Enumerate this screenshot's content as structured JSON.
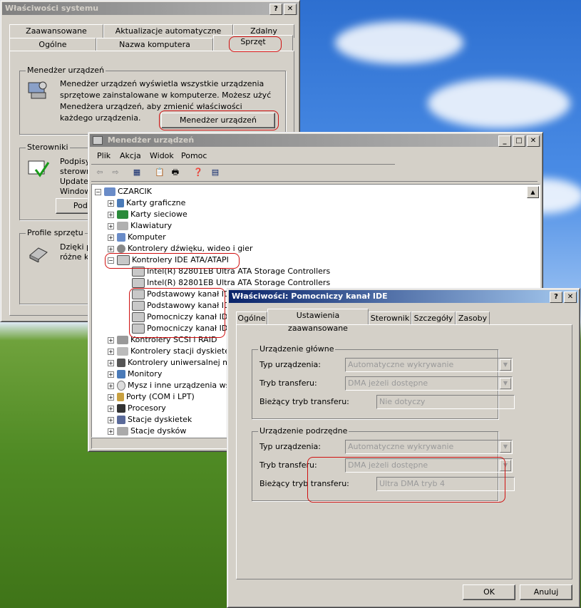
{
  "colors": {
    "highlight_red": "#d01010",
    "title_active": "#0a246a",
    "title_inactive": "#808080"
  },
  "sys_props": {
    "title": "Właściwości systemu",
    "help_btn": "?",
    "close_btn": "✕",
    "tabs_top": [
      "Zaawansowane",
      "Aktualizacje automatyczne",
      "Zdalny"
    ],
    "tabs_bottom": [
      "Ogólne",
      "Nazwa komputera",
      "Sprzęt"
    ],
    "devmgr_group": {
      "title": "Menedżer urządzeń",
      "text": "Menedżer urządzeń wyświetla wszystkie urządzenia sprzętowe zainstalowane w komputerze. Możesz użyć Menedżera urządzeń, aby zmienić właściwości każdego urządzenia.",
      "button": "Menedżer urządzeń"
    },
    "drivers_group": {
      "title": "Sterowniki",
      "lines": [
        "Podpisy",
        "sterown",
        "Update",
        "Window"
      ],
      "button": "Podpisy"
    },
    "profiles_group": {
      "title": "Profile sprzętu",
      "lines": [
        "Dzięki p",
        "różne ko"
      ]
    }
  },
  "dev_mgr": {
    "title": "Menedżer urządzeń",
    "min_btn": "_",
    "max_btn": "□",
    "close_btn": "✕",
    "menu": [
      "Plik",
      "Akcja",
      "Widok",
      "Pomoc"
    ],
    "toolbar_icons": [
      "back-icon",
      "forward-icon",
      "view-icon",
      "properties-icon",
      "print-icon",
      "help-icon",
      "details-icon"
    ],
    "toolbar_glyphs": [
      "⇦",
      "⇨",
      "▦",
      "📋",
      "🖶",
      "❓",
      "▤"
    ],
    "root": "CZARCIK",
    "items": [
      "Karty graficzne",
      "Karty sieciowe",
      "Klawiatury",
      "Komputer",
      "Kontrolery dźwięku, wideo i gier",
      "Kontrolery IDE ATA/ATAPI"
    ],
    "ide_children": [
      "Intel(R) 82801EB Ultra ATA Storage Controllers",
      "Intel(R) 82801EB Ultra ATA Storage Controllers",
      "Podstawowy kanał IDE",
      "Podstawowy kanał IDE",
      "Pomocniczy kanał IDE",
      "Pomocniczy kanał IDE"
    ],
    "items_after": [
      "Kontrolery SCSI i RAID",
      "Kontrolery stacji dyskietek",
      "Kontrolery uniwersalnej ma",
      "Monitory",
      "Mysz i inne urządzenia wska",
      "Porty (COM i LPT)",
      "Procesory",
      "Stacje dyskietek",
      "Stacje dysków"
    ],
    "expander_plus": "+",
    "expander_minus": "−",
    "scroll_up": "▲"
  },
  "ide_props": {
    "title": "Właściwości: Pomocniczy kanał IDE",
    "help_btn": "?",
    "close_btn": "✕",
    "tabs": [
      "Ogólne",
      "Ustawienia zaawansowane",
      "Sterownik",
      "Szczegóły",
      "Zasoby"
    ],
    "master": {
      "title": "Urządzenie główne",
      "device_type_label": "Typ urządzenia:",
      "device_type_value": "Automatyczne wykrywanie",
      "transfer_mode_label": "Tryb transferu:",
      "transfer_mode_value": "DMA jeżeli dostępne",
      "current_mode_label": "Bieżący tryb transferu:",
      "current_mode_value": "Nie dotyczy"
    },
    "slave": {
      "title": "Urządzenie podrzędne",
      "device_type_label": "Typ urządzenia:",
      "device_type_value": "Automatyczne wykrywanie",
      "transfer_mode_label": "Tryb transferu:",
      "transfer_mode_value": "DMA jeżeli dostępne",
      "current_mode_label": "Bieżący tryb transferu:",
      "current_mode_value": "Ultra DMA tryb 4"
    },
    "combo_arrow": "▼",
    "ok": "OK",
    "cancel": "Anuluj"
  }
}
